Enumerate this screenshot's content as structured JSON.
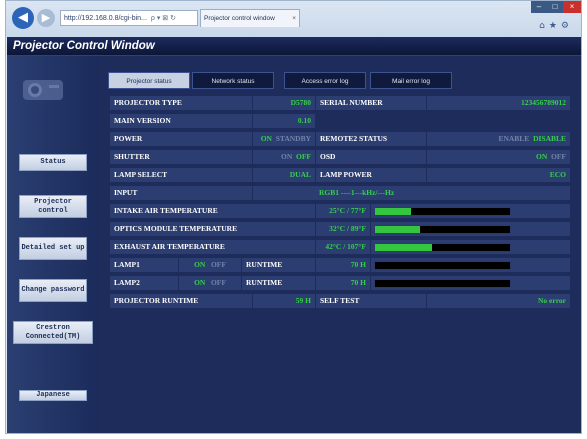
{
  "browser": {
    "address": "http://192.168.0.8/cgi-bin...",
    "address_tools": "ρ ▾ ⊠ ↻",
    "tab_title": "Projector control window",
    "tab_close": "×",
    "back_icon": "arrow-left-icon",
    "forward_icon": "arrow-right-icon"
  },
  "app": {
    "title": "Projector Control Window"
  },
  "sidebar": {
    "items": [
      {
        "label": "Status"
      },
      {
        "label": "Projector control"
      },
      {
        "label": "Detailed set up"
      },
      {
        "label": "Change password"
      },
      {
        "label": "Crestron Connected(TM)"
      },
      {
        "label": "Japanese"
      }
    ]
  },
  "tabs": [
    {
      "label": "Projector status",
      "active": true
    },
    {
      "label": "Network status",
      "active": false
    },
    {
      "label": "Access error log",
      "active": false
    },
    {
      "label": "Mail error log",
      "active": false
    }
  ],
  "status": {
    "projector_type": {
      "label": "PROJECTOR TYPE",
      "value": "D5780"
    },
    "serial_number": {
      "label": "SERIAL NUMBER",
      "value": "123456789012"
    },
    "main_version": {
      "label": "MAIN VERSION",
      "value": "0.10"
    },
    "power": {
      "label": "POWER",
      "on": "ON",
      "standby": "STANDBY"
    },
    "remote2": {
      "label": "REMOTE2 STATUS",
      "enable": "ENABLE",
      "disable": "DISABLE"
    },
    "shutter": {
      "label": "SHUTTER",
      "on": "ON",
      "off": "OFF"
    },
    "osd": {
      "label": "OSD",
      "on": "ON",
      "off": "OFF"
    },
    "lamp_select": {
      "label": "LAMP SELECT",
      "value": "DUAL"
    },
    "lamp_power": {
      "label": "LAMP POWER",
      "value": "ECO"
    },
    "input": {
      "label": "INPUT",
      "value": "RGB1 ----1---kHz/---Hz"
    },
    "intake_temp": {
      "label": "INTAKE AIR TEMPERATURE",
      "value": "25°C / 77°F",
      "level": 0.27
    },
    "optics_temp": {
      "label": "OPTICS MODULE TEMPERATURE",
      "value": "32°C / 89°F",
      "level": 0.33
    },
    "exhaust_temp": {
      "label": "EXHAUST AIR TEMPERATURE",
      "value": "42°C / 107°F",
      "level": 0.42
    },
    "lamp1": {
      "label": "LAMP1",
      "on": "ON",
      "off": "OFF",
      "runtime_label": "RUNTIME",
      "runtime": "70 H",
      "level": 0.0
    },
    "lamp2": {
      "label": "LAMP2",
      "on": "ON",
      "off": "OFF",
      "runtime_label": "RUNTIME",
      "runtime": "70 H",
      "level": 0.0
    },
    "projector_runtime": {
      "label": "PROJECTOR RUNTIME",
      "value": "59 H"
    },
    "self_test": {
      "label": "SELF TEST",
      "value": "No error"
    }
  },
  "colors": {
    "accent_green": "#35d04a",
    "dim_text": "#7283ab",
    "panel": "#2c3d71",
    "background": "#1e2c5c"
  }
}
